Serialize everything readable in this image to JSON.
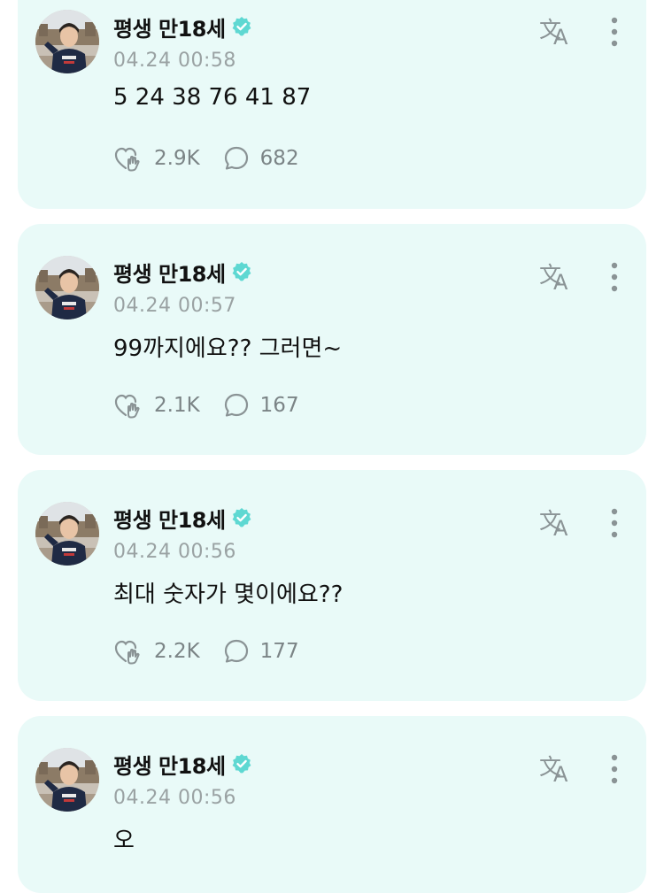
{
  "colors": {
    "card_bg": "#e9faf8",
    "verified": "#5ed8d2",
    "meta_text": "#9aa2a3",
    "icon": "#8a9395"
  },
  "icons": {
    "translate": "translate-icon",
    "more": "more-vertical-icon",
    "reaction": "heart-hand-icon",
    "comment": "comment-bubble-icon",
    "verified": "verified-badge-icon"
  },
  "posts": [
    {
      "author": "평생 만18세",
      "time": "04.24 00:58",
      "text": "5 24 38 76 41 87",
      "likes": "2.9K",
      "comments": "682"
    },
    {
      "author": "평생 만18세",
      "time": "04.24 00:57",
      "text": "99까지에요?? 그러면~",
      "likes": "2.1K",
      "comments": "167"
    },
    {
      "author": "평생 만18세",
      "time": "04.24 00:56",
      "text": "최대 숫자가 몇이에요??",
      "likes": "2.2K",
      "comments": "177"
    },
    {
      "author": "평생 만18세",
      "time": "04.24 00:56",
      "text": "오"
    }
  ]
}
